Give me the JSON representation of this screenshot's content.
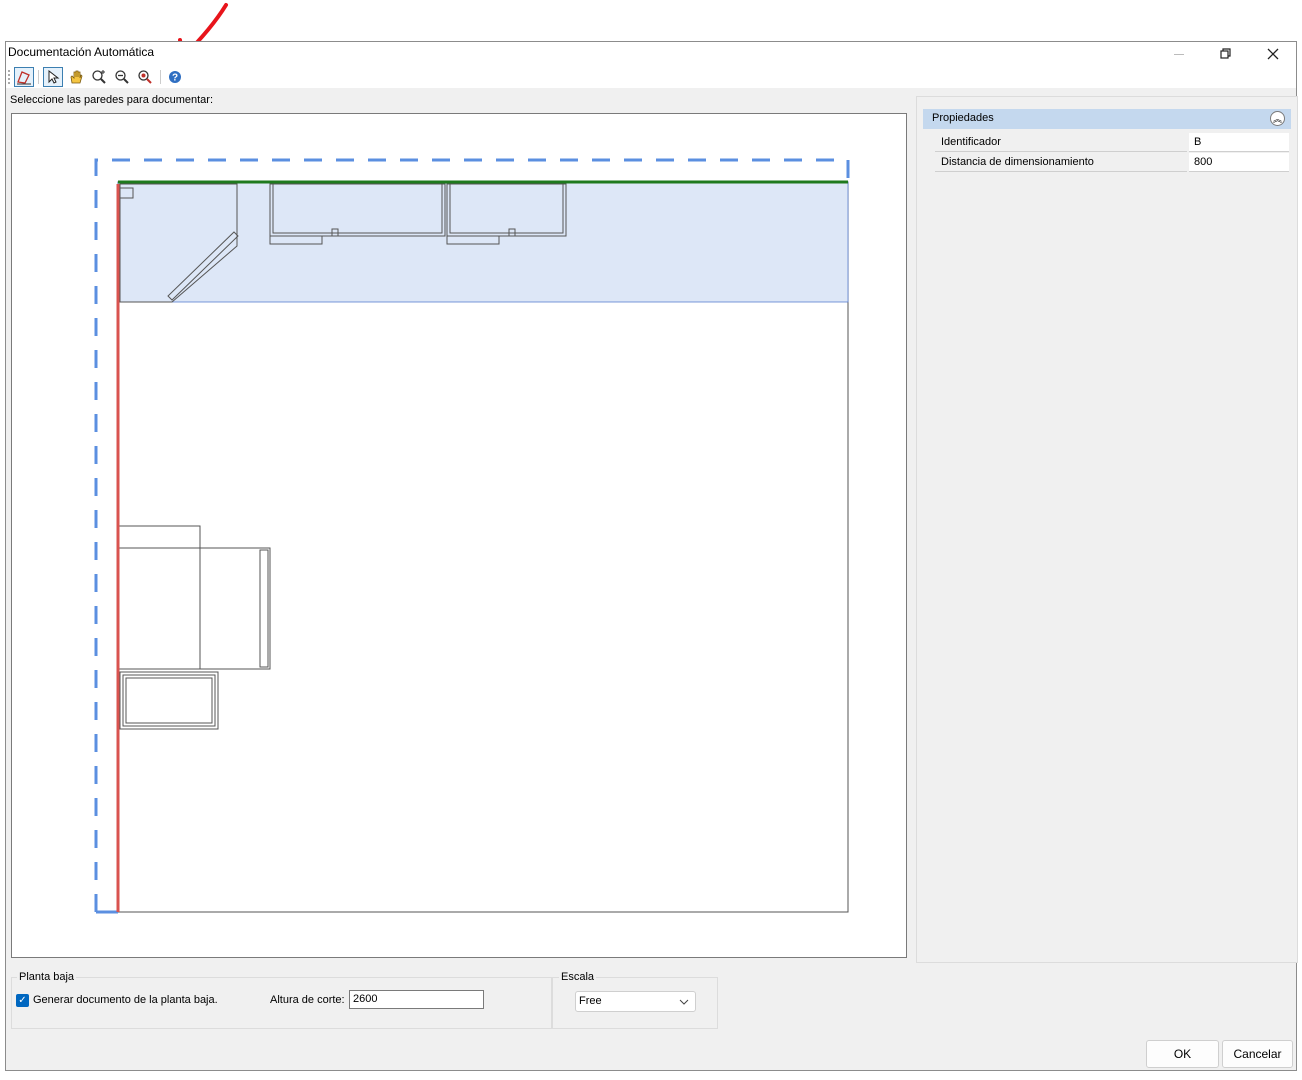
{
  "window": {
    "title": "Documentación Automática",
    "minimize_icon": "minimize-icon",
    "restore_icon": "restore-icon",
    "close_icon": "close-icon"
  },
  "toolbar": {
    "tools": [
      {
        "name": "select-wall-tool",
        "icon": "wall-select-icon",
        "active": true
      },
      {
        "name": "pointer-tool",
        "icon": "pointer-icon",
        "active": true
      },
      {
        "name": "pan-tool",
        "icon": "hand-icon",
        "active": false
      },
      {
        "name": "zoom-in-tool",
        "icon": "zoom-in-icon",
        "active": false
      },
      {
        "name": "zoom-out-tool",
        "icon": "zoom-out-icon",
        "active": false
      },
      {
        "name": "zoom-extents-tool",
        "icon": "zoom-extents-icon",
        "active": false
      },
      {
        "name": "help-tool",
        "icon": "help-icon",
        "active": false
      }
    ]
  },
  "annotation": {
    "arrow_color": "#e8141b"
  },
  "prompt": "Seleccione las paredes para documentar:",
  "properties": {
    "header": "Propiedades",
    "rows": [
      {
        "name": "Identificador",
        "value": "B"
      },
      {
        "name": "Distancia de dimensionamiento",
        "value": "800"
      }
    ]
  },
  "ground_floor": {
    "group_label": "Planta baja",
    "checkbox_label": "Generar documento de la planta baja.",
    "checked": true,
    "cut_height_label": "Altura de corte:",
    "cut_height_value": "2600"
  },
  "scale": {
    "group_label": "Escala",
    "selected": "Free"
  },
  "buttons": {
    "ok": "OK",
    "cancel": "Cancelar"
  },
  "colors": {
    "selection_dashed": "#5b8fe0",
    "selected_wall_green": "#1e7a1e",
    "selected_wall_red": "#d9534f",
    "highlight_fill": "#dde7f7",
    "props_header": "#c4d8ee",
    "accent": "#0067c0"
  }
}
